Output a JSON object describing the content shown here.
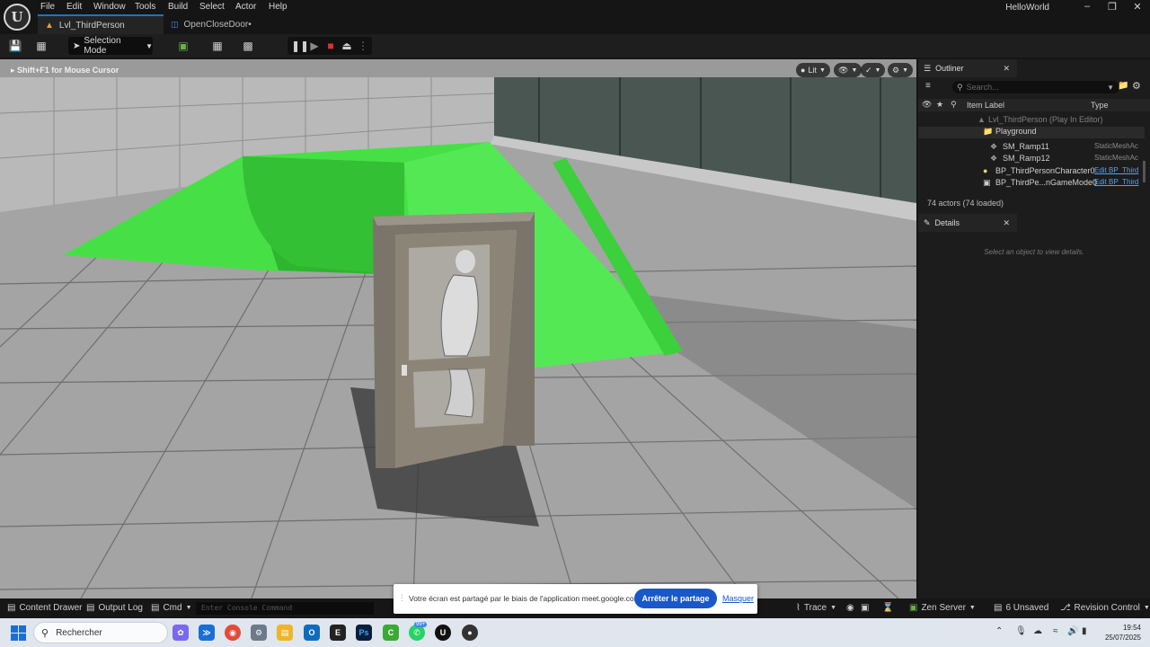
{
  "menu": {
    "items": [
      "File",
      "Edit",
      "Window",
      "Tools",
      "Build",
      "Select",
      "Actor",
      "Help"
    ],
    "window_title": "HelloWorld"
  },
  "tabs": {
    "level": "Lvl_ThirdPerson",
    "blueprint": "OpenCloseDoor•"
  },
  "toolbar": {
    "mode_label": "Selection Mode"
  },
  "viewport": {
    "hint": "Shift+F1 for Mouse Cursor",
    "lit_label": "Lit",
    "colors": {
      "floor": "#a4a4a4",
      "green": "#44e044",
      "wall": "#3a4a44"
    }
  },
  "outliner": {
    "title": "Outliner",
    "search_placeholder": "Search...",
    "col_label": "Item Label",
    "col_type": "Type",
    "rows": [
      {
        "label": "Lvl_ThirdPerson (Play In Editor)",
        "type": "",
        "kind": "world"
      },
      {
        "label": "Playground",
        "type": "",
        "kind": "folder"
      },
      {
        "label": "SM_Ramp11",
        "type": "StaticMeshAc",
        "kind": "mesh"
      },
      {
        "label": "SM_Ramp12",
        "type": "StaticMeshAc",
        "kind": "mesh"
      },
      {
        "label": "BP_ThirdPersonCharacter0",
        "type": "Edit BP_Third",
        "kind": "pawn"
      },
      {
        "label": "BP_ThirdPe...nGameMode0",
        "type": "Edit BP_Third",
        "kind": "gamemode"
      }
    ],
    "actor_count": "74 actors (74 loaded)"
  },
  "details": {
    "title": "Details",
    "empty_hint": "Select an object to view details."
  },
  "statusbar": {
    "content_drawer": "Content Drawer",
    "output_log": "Output Log",
    "cmd": "Cmd",
    "console_placeholder": "Enter Console Command",
    "trace": "Trace",
    "zen": "Zen Server",
    "unsaved": "6 Unsaved",
    "revision": "Revision Control"
  },
  "share_banner": {
    "message": "Votre écran est partagé par le biais de l'application meet.google.com.",
    "stop_label": "Arrêter le partage",
    "hide_label": "Masquer"
  },
  "taskbar": {
    "search_label": "Rechercher",
    "whatsapp_badge": "99+",
    "time": "19:54",
    "date": "25/07/2025"
  }
}
